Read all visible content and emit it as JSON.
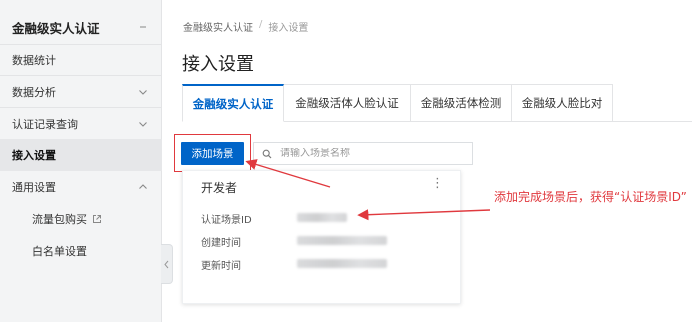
{
  "sidebar": {
    "title": "金融级实人认证",
    "items": [
      {
        "label": "数据统计"
      },
      {
        "label": "数据分析"
      },
      {
        "label": "认证记录查询"
      },
      {
        "label": "接入设置"
      },
      {
        "label": "通用设置"
      }
    ],
    "sub_items": [
      {
        "label": "流量包购买"
      },
      {
        "label": "白名单设置"
      }
    ]
  },
  "breadcrumb": {
    "root": "金融级实人认证",
    "separator": "/",
    "current": "接入设置"
  },
  "page_title": "接入设置",
  "tabs": [
    {
      "label": "金融级实人认证",
      "active": true
    },
    {
      "label": "金融级活体人脸认证"
    },
    {
      "label": "金融级活体检测"
    },
    {
      "label": "金融级人脸比对"
    }
  ],
  "toolbar": {
    "add_label": "添加场景",
    "search_placeholder": "请输入场景名称"
  },
  "card": {
    "title": "开发者",
    "more_label": "⋮",
    "rows": [
      {
        "label": "认证场景ID"
      },
      {
        "label": "创建时间"
      },
      {
        "label": "更新时间"
      }
    ]
  },
  "annotation": {
    "text": "添加完成场景后，获得“认证场景ID”"
  },
  "colors": {
    "accent": "#0064c8",
    "annotation": "#e0393e",
    "brand": "#ff6a00"
  }
}
